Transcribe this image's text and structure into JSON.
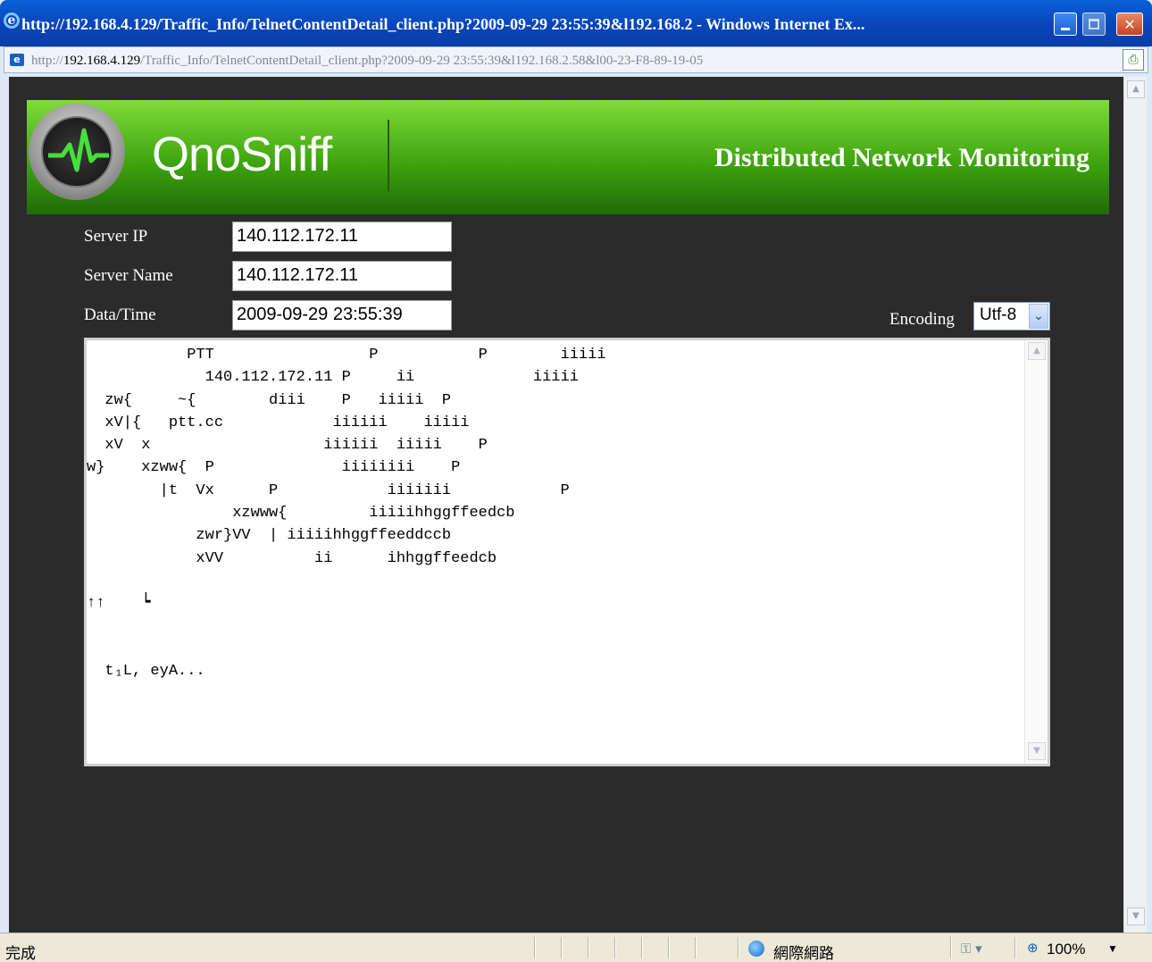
{
  "window": {
    "title": "http://192.168.4.129/Traffic_Info/TelnetContentDetail_client.php?2009-09-29 23:55:39&l192.168.2 - Windows Internet Ex...",
    "minimize": "_",
    "close": "✕"
  },
  "address": {
    "url_prefix": "http://",
    "url_host": "192.168.4.129",
    "url_path": "/Traffic_Info/TelnetContentDetail_client.php?2009-09-29 23:55:39&l192.168.2.58&l00-23-F8-89-19-05"
  },
  "header": {
    "brand": "QnoSniff",
    "tagline": "Distributed Network Monitoring"
  },
  "form": {
    "server_ip_label": "Server IP",
    "server_ip_value": "140.112.172.11",
    "server_name_label": "Server Name",
    "server_name_value": "140.112.172.11",
    "datetime_label": "Data/Time",
    "datetime_value": "2009-09-29 23:55:39",
    "encoding_label": "Encoding",
    "encoding_value": "Utf-8"
  },
  "content": {
    "text": "           PTT                 P           P        iiiii\n             140.112.172.11 P     ii             iiiii\n  zw{     ~{        diii    P   iiiii  P\n  xV|{   ptt.cc            iiiiii    iiiii\n  xV  x                   iiiiii  iiiii    P\nw}    xzww{  P              iiiiiiii    P\n        |t  Vx      P            iiiiiii            P\n                xzwww{         iiiiihhggffeedcb\n            zwr}VV  | iiiiihhggffeeddccb\n            xVV          ii      ihhggffeedcb\n\n↑↑    ┕\n\n\n  t₁L, eyA..."
  },
  "status": {
    "left": "完成",
    "zone": "網際網路",
    "zoom": "100%"
  },
  "colors": {
    "banner_green": "#3fa40f",
    "page_bg": "#2b2b2b",
    "titlebar_blue": "#0845b8"
  }
}
